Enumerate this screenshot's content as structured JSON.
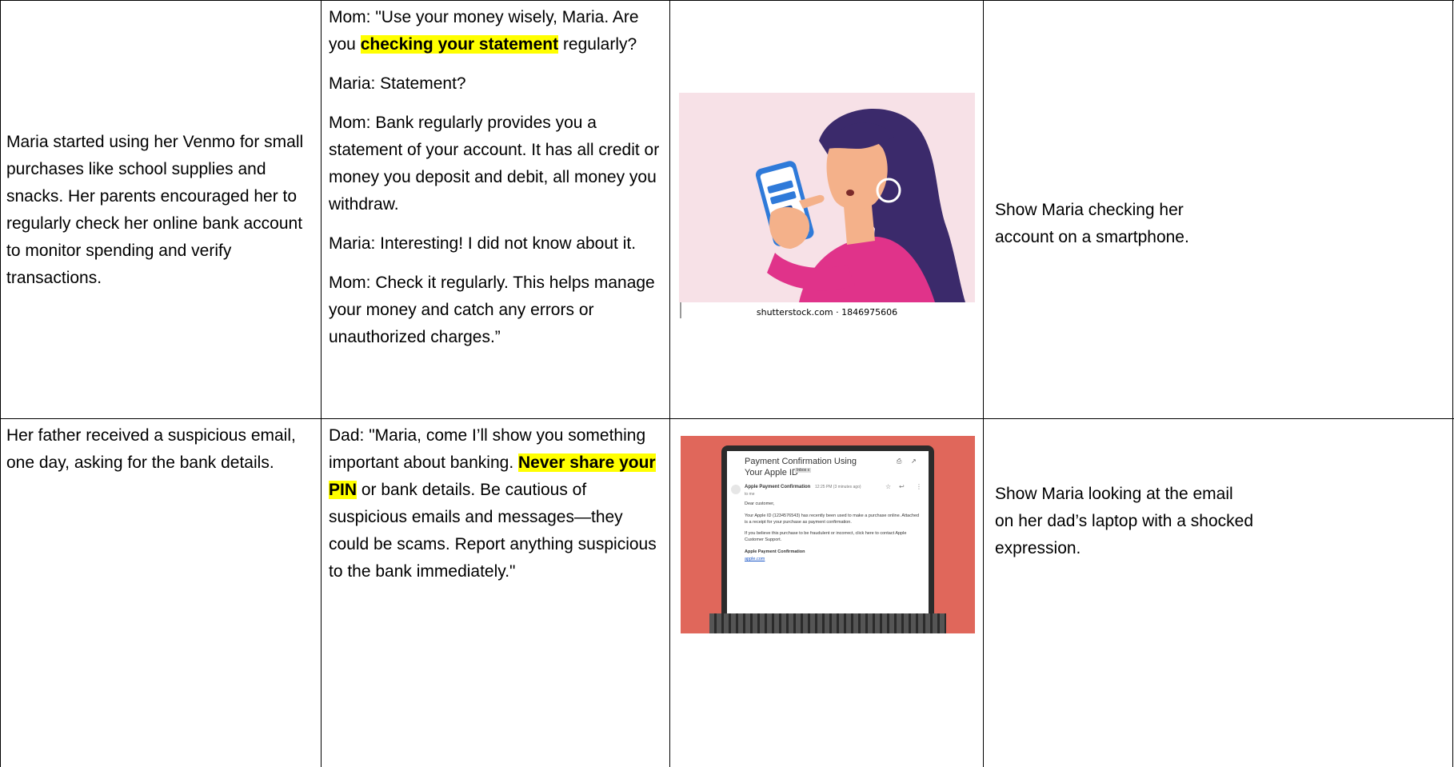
{
  "rows": [
    {
      "narration": "Maria started using her Venmo for small purchases like school supplies and snacks. Her parents encouraged her to regularly check her online bank account to monitor spending and verify transactions.",
      "dialogue": [
        {
          "before": "Mom: \"Use your money wisely, Maria. Are you ",
          "highlight": "checking your statement",
          "after": " regularly?"
        },
        {
          "text": "Maria: Statement?"
        },
        {
          "text": "Mom: Bank regularly provides you a statement of your account. It has all credit or money you deposit and debit, all money you withdraw."
        },
        {
          "text": "Maria: Interesting! I did not know about it."
        },
        {
          "text": "Mom: Check it regularly. This helps manage your money and catch any errors or unauthorized charges.”"
        }
      ],
      "image": {
        "caption": "shutterstock.com · 1846975606",
        "colors": {
          "background": "#f7e1e7",
          "hair": "#3b2a6b",
          "shirt": "#e0338a",
          "skin": "#f4b18a",
          "phone": "#2f7ad9"
        }
      },
      "direction": "Show Maria checking her account on a smartphone."
    },
    {
      "narration": "Her father received a suspicious email, one day, asking for the bank details.",
      "dialogue": [
        {
          "before": "Dad: \"Maria, come I’ll show you something important about banking. ",
          "highlight": "Never share your PIN",
          "after": " or bank details. Be cautious of suspicious emails and messages—they could be scams. Report anything suspicious to the bank immediately.\""
        }
      ],
      "image": {
        "email_title": "Payment Confirmation Using Your Apple ID",
        "inbox_tag": "Inbox x",
        "sender": "Apple Payment Confirmation",
        "time": "12:25 PM (3 minutes ago)",
        "to": "to me",
        "greeting": "Dear customer,",
        "body1": "Your Apple ID (1234576543) has recently been used to make a purchase online. Attached is a receipt for your purchase as payment confirmation.",
        "body2": "If you believe this purchase to be fraudulent or incorrect, click here to contact Apple Customer Support.",
        "signature": "Apple Payment Confirmation",
        "link": "apple.com",
        "colors": {
          "background": "#e0675b",
          "laptop": "#2b2b2b",
          "screen": "#ffffff",
          "link": "#1a55c7"
        }
      },
      "direction": "Show Maria looking at the email on her dad’s laptop with a shocked expression."
    }
  ]
}
